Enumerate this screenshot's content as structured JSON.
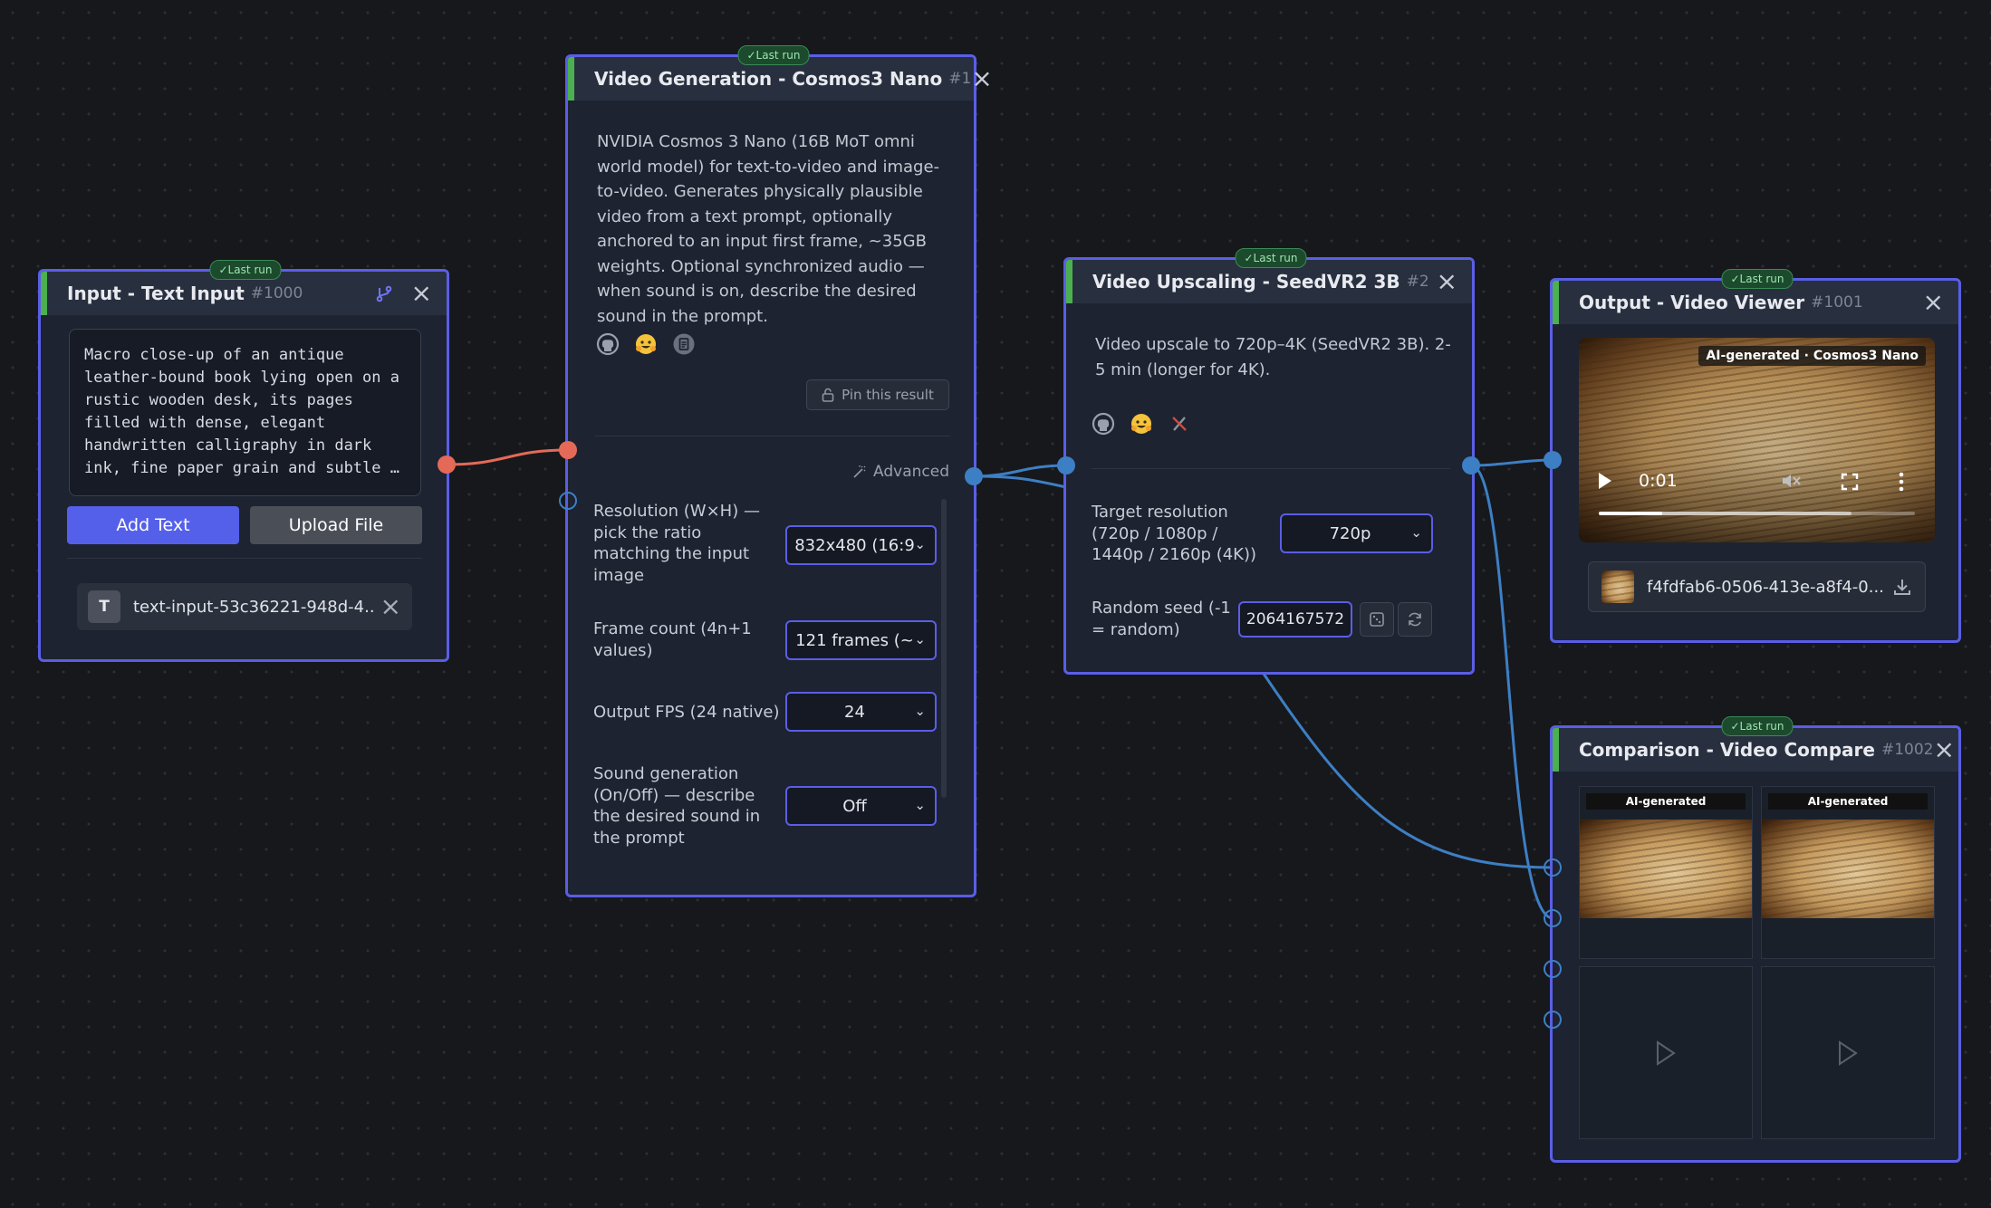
{
  "text_input_node": {
    "title": "Input - Text Input",
    "id": "#1000",
    "last_run": "✓Last run",
    "prompt": "Macro close-up of an antique leather-bound book lying open on a rustic wooden desk, its pages filled with dense, elegant handwritten calligraphy in dark ink, fine paper grain and subtle …",
    "add_text_label": "Add Text",
    "upload_file_label": "Upload File",
    "chip_letter": "T",
    "chip_label": "text-input-53c36221-948d-4..."
  },
  "video_gen_node": {
    "title": "Video Generation - Cosmos3 Nano",
    "id": "#1",
    "last_run": "✓Last run",
    "description": "NVIDIA Cosmos 3 Nano (16B MoT omni world model) for text-to-video and image-to-video. Generates physically plausible video from a text prompt, optionally anchored to an input first frame, ~35GB weights. Optional synchronized audio — when sound is on, describe the desired sound in the prompt.",
    "pin_label": "Pin this result",
    "advanced_label": "Advanced",
    "params": [
      {
        "label": "Resolution (W×H) — pick the ratio matching the input image",
        "value": "832x480 (16:9"
      },
      {
        "label": "Frame count (4n+1 values)",
        "value": "121 frames (~"
      },
      {
        "label": "Output FPS (24 native)",
        "value": "24"
      },
      {
        "label": "Sound generation (On/Off) — describe the desired sound in the prompt",
        "value": "Off"
      }
    ]
  },
  "upscale_node": {
    "title": "Video Upscaling - SeedVR2 3B",
    "id": "#2",
    "last_run": "✓Last run",
    "description": "Video upscale to 720p–4K (SeedVR2 3B). 2-5 min (longer for 4K).",
    "resolution_label": "Target resolution (720p / 1080p / 1440p / 2160p (4K))",
    "resolution_value": "720p",
    "seed_label": "Random seed (-1 = random)",
    "seed_value": "2064167572"
  },
  "viewer_node": {
    "title": "Output - Video Viewer",
    "id": "#1001",
    "last_run": "✓Last run",
    "overlay_label": "AI-generated · Cosmos3 Nano",
    "time": "0:01",
    "progress": 0.2,
    "buffered": 0.8,
    "file_name": "f4fdfab6-0506-413e-a8f4-0..."
  },
  "compare_node": {
    "title": "Comparison - Video Compare",
    "id": "#1002",
    "last_run": "✓Last run",
    "slot_labels": [
      "AI-generated",
      "AI-generated"
    ]
  },
  "colors": {
    "accent": "#5a5ee6",
    "wire_text": "#e46a57",
    "wire_video": "#3d7fc4",
    "status_green": "#4caf50"
  },
  "icons": [
    "github-icon",
    "huggingface-icon",
    "paper-icon",
    "lock-icon",
    "wand-icon",
    "dice-icon",
    "refresh-icon",
    "download-icon",
    "play-icon",
    "mute-icon",
    "fullscreen-icon",
    "more-icon",
    "branch-icon",
    "no-tool-icon"
  ]
}
